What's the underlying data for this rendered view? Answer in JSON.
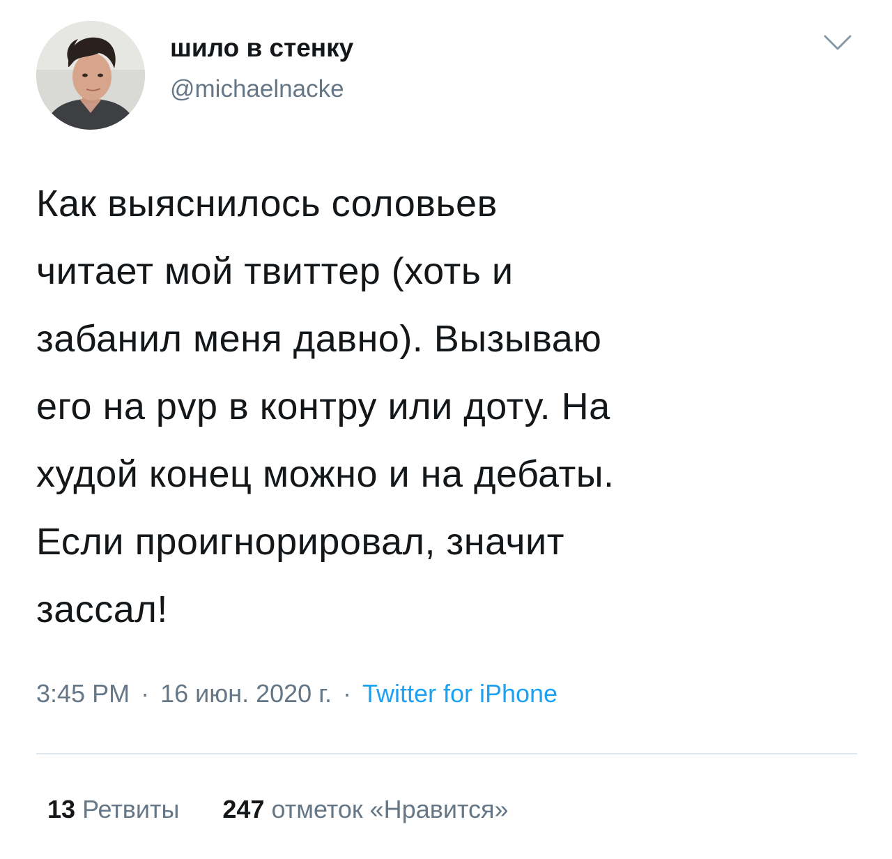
{
  "author": {
    "display_name": "шило в стенку",
    "handle": "@michaelnacke",
    "avatar": "profile-photo"
  },
  "menu": {
    "icon": "chevron-down-icon"
  },
  "tweet": {
    "text": "Как выяснилось соловьев\nчитает мой твиттер (хоть и\nзабанил меня давно). Вызываю\nего на pvp в контру или доту. На\nхудой конец можно и на дебаты.\nЕсли проигнорировал, значит\nзассал!"
  },
  "meta": {
    "time": "3:45 PM",
    "separator": "·",
    "date": "16 июн. 2020 г.",
    "source": "Twitter for iPhone"
  },
  "stats": {
    "retweets_count": "13",
    "retweets_label": "Ретвиты",
    "likes_count": "247",
    "likes_label": "отметок «Нравится»"
  },
  "colors": {
    "text": "#14171a",
    "secondary": "#657786",
    "link": "#1da1f2",
    "divider": "#e1e8ed"
  }
}
